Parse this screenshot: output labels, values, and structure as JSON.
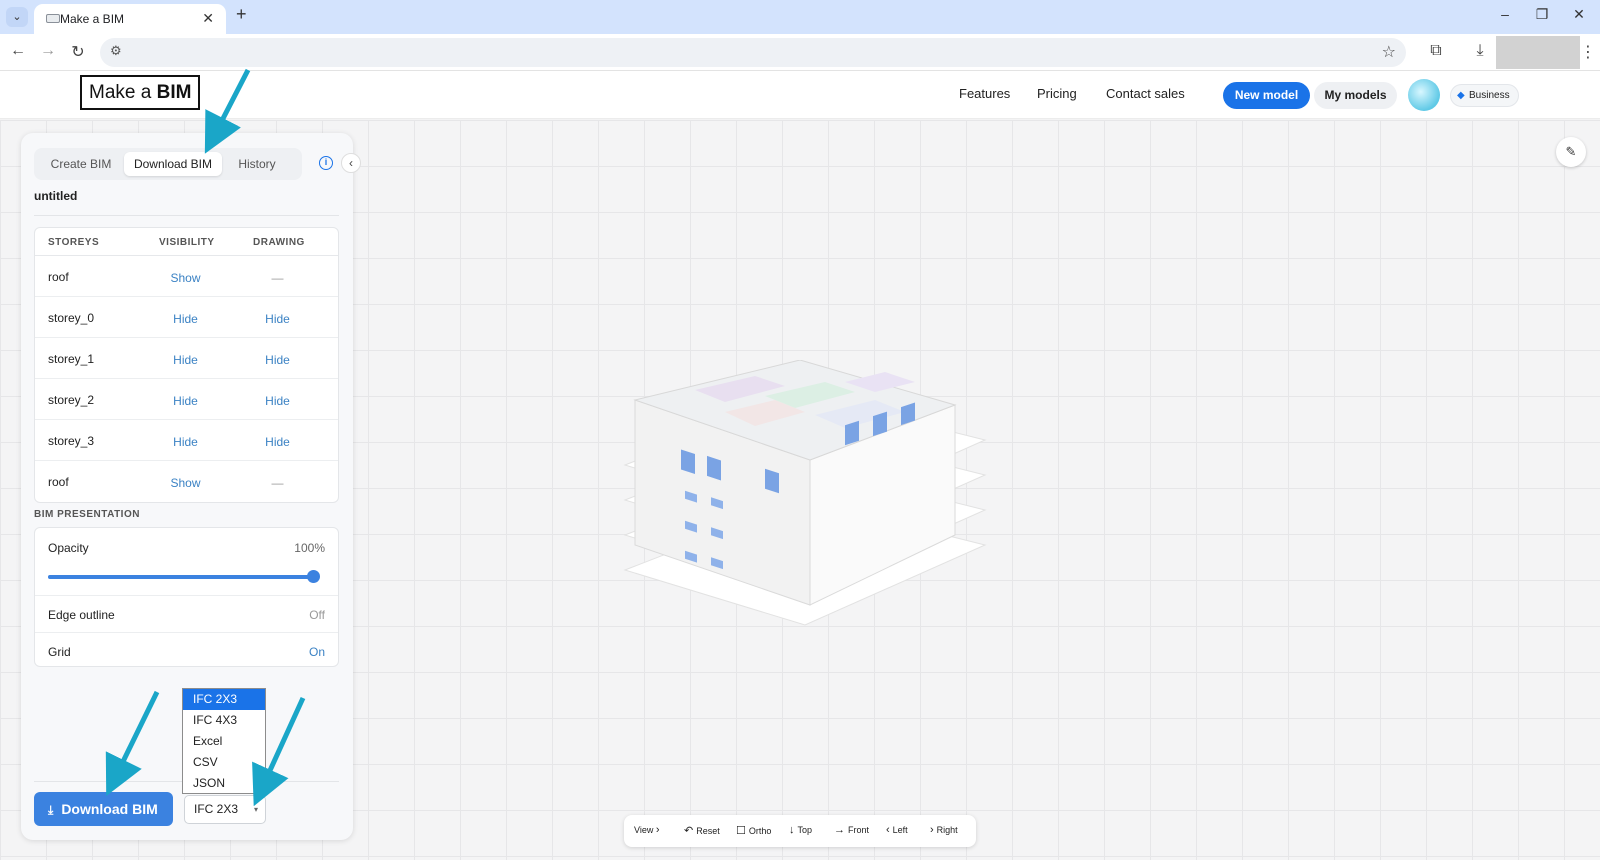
{
  "browser": {
    "tab_title": "Make a BIM",
    "tab_close": "✕",
    "new_tab": "+",
    "tab_list": "⌄",
    "minimize": "–",
    "restore": "❐",
    "close": "✕",
    "back": "←",
    "forward": "→",
    "reload": "↻",
    "site_info": "⚙",
    "bookmark": "☆",
    "extensions": "⧉",
    "downloads": "⤓",
    "menu": "⋮"
  },
  "header": {
    "logo_prefix": "Make a ",
    "logo_bold": "BIM",
    "nav": [
      "Features",
      "Pricing",
      "Contact sales"
    ],
    "new_model": "New model",
    "my_models": "My models",
    "business": "Business",
    "business_icon": "◆"
  },
  "panel": {
    "tabs": [
      "Create BIM",
      "Download BIM",
      "History"
    ],
    "active_tab": "Download BIM",
    "info_icon": "i",
    "collapse_icon": "‹",
    "model_name": "untitled",
    "storeys_header": {
      "name": "STOREYS",
      "visibility": "VISIBILITY",
      "drawing": "DRAWING"
    },
    "storeys": [
      {
        "name": "roof",
        "visibility": "Show",
        "drawing": "—"
      },
      {
        "name": "storey_0",
        "visibility": "Hide",
        "drawing": "Hide"
      },
      {
        "name": "storey_1",
        "visibility": "Hide",
        "drawing": "Hide"
      },
      {
        "name": "storey_2",
        "visibility": "Hide",
        "drawing": "Hide"
      },
      {
        "name": "storey_3",
        "visibility": "Hide",
        "drawing": "Hide"
      },
      {
        "name": "roof",
        "visibility": "Show",
        "drawing": "—"
      }
    ],
    "presentation_title": "BIM PRESENTATION",
    "opacity_label": "Opacity",
    "opacity_value": "100%",
    "opacity_fraction": 1.0,
    "edge_label": "Edge outline",
    "edge_value": "Off",
    "grid_label": "Grid",
    "grid_value": "On",
    "download_label": "Download BIM",
    "download_icon": "⤓",
    "format_selected": "IFC 2X3",
    "format_caret": "▾",
    "format_options": [
      "IFC 2X3",
      "IFC 4X3",
      "Excel",
      "CSV",
      "JSON"
    ]
  },
  "view_toolbar": {
    "view": "View",
    "reset": "Reset",
    "ortho": "Ortho",
    "top": "Top",
    "front": "Front",
    "left": "Left",
    "right": "Right",
    "icons": {
      "view": "›",
      "reset": "↶",
      "ortho": "☐",
      "top": "↓",
      "front": "→",
      "left": "‹",
      "right": "›"
    }
  },
  "notes_icon": "✎",
  "colors": {
    "accent": "#1a73e8",
    "link": "#3b82c4",
    "annotation": "#1aa6c8"
  }
}
